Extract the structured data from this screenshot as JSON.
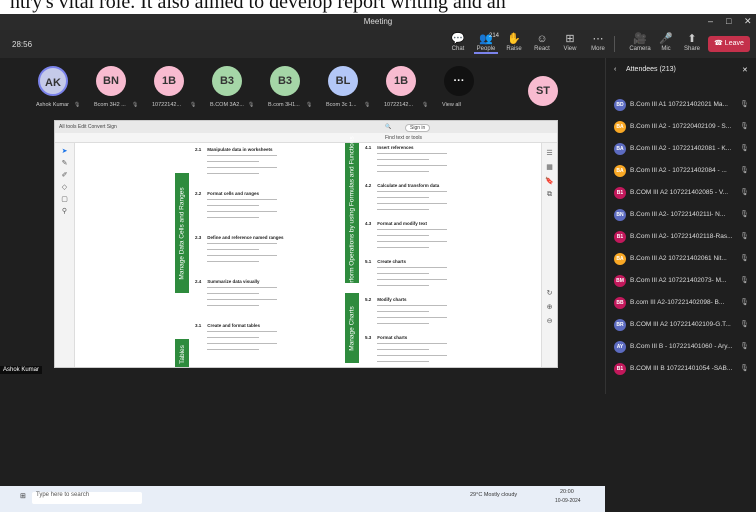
{
  "caption_strip": "ntry's vital role. It also aimed to develop report writing and an",
  "window": {
    "title": "Meeting",
    "minimize": "–",
    "maximize": "□",
    "close": "✕"
  },
  "toolbar": {
    "timer": "28:56",
    "buttons": [
      {
        "icon": "💬",
        "label": "Chat"
      },
      {
        "icon": "👥",
        "label": "People",
        "count": "214"
      },
      {
        "icon": "✋",
        "label": "Raise"
      },
      {
        "icon": "☺",
        "label": "React"
      },
      {
        "icon": "⊞",
        "label": "View"
      },
      {
        "icon": "⋯",
        "label": "More"
      },
      {
        "icon": "🎥",
        "label": "Camera"
      },
      {
        "icon": "🎤",
        "label": "Mic"
      },
      {
        "icon": "⬆",
        "label": "Share"
      }
    ],
    "leave_label": "Leave"
  },
  "participants": [
    {
      "initials": "AK",
      "name": "Ashok Kumar",
      "color": "#c5cae9"
    },
    {
      "initials": "BN",
      "name": "Bcom 3H2 ...",
      "color": "#f8bbd0"
    },
    {
      "initials": "1B",
      "name": "10722142...",
      "color": "#f8bbd0"
    },
    {
      "initials": "B3",
      "name": "B.COM 3A2...",
      "color": "#a5d6a7"
    },
    {
      "initials": "B3",
      "name": "B.com 3H1...",
      "color": "#a5d6a7"
    },
    {
      "initials": "BL",
      "name": "Bcom 3c 1...",
      "color": "#b3c7f7"
    },
    {
      "initials": "1B",
      "name": "10722142...",
      "color": "#f8bbd0"
    },
    {
      "initials": "···",
      "name": "View all",
      "color": "#111111"
    },
    {
      "initials": "ST",
      "name": "",
      "color": "#f8bbd0"
    }
  ],
  "pdf": {
    "find_label": "Find text or tools",
    "sign_in": "Sign in",
    "page_label": "All tools   Edit   Convert   Sign",
    "bands": [
      "Manage Data Cells and Ranges",
      "Perform Operations by using Formulas and Functions",
      "Manage Charts",
      "Tables"
    ],
    "sections_left": [
      {
        "num": "2.1",
        "title": "Manipulate data in worksheets"
      },
      {
        "num": "2.2",
        "title": "Format cells and ranges"
      },
      {
        "num": "2.3",
        "title": "Define and reference named ranges"
      },
      {
        "num": "2.4",
        "title": "Summarize data visually"
      },
      {
        "num": "3.1",
        "title": "Create and format tables"
      }
    ],
    "sections_right": [
      {
        "num": "4.1",
        "title": "Insert references"
      },
      {
        "num": "4.2",
        "title": "Calculate and transform data"
      },
      {
        "num": "4.3",
        "title": "Format and modify text"
      },
      {
        "num": "5.1",
        "title": "Create charts"
      },
      {
        "num": "5.2",
        "title": "Modify charts"
      },
      {
        "num": "5.3",
        "title": "Format charts"
      }
    ]
  },
  "presenter_name": "Ashok Kumar",
  "taskbar": {
    "search": "Type here to search",
    "weather": "29°C  Mostly cloudy",
    "time": "20:00",
    "date": "10-09-2024"
  },
  "attendees": {
    "title": "Attendees (213)",
    "list": [
      {
        "initials": "BD",
        "name": "B.Com III A1 107221402021 Ma...",
        "color": "#5c6bc0"
      },
      {
        "initials": "BA",
        "name": "B.Com III A2 - 107220402109 - S...",
        "color": "#f9a825"
      },
      {
        "initials": "BA",
        "name": "B.Com III A2 - 107221402081 - K...",
        "color": "#5c6bc0"
      },
      {
        "initials": "BA",
        "name": "B.Com III A2 - 107221402084 - ...",
        "color": "#f9a825"
      },
      {
        "initials": "B1",
        "name": "B.COM III A2 107221402085 - V...",
        "color": "#c2185b"
      },
      {
        "initials": "BN",
        "name": "B.Com III A2- 10722140211l- N...",
        "color": "#5c6bc0"
      },
      {
        "initials": "B1",
        "name": "B.Com III A2- 107221402118-Ras...",
        "color": "#c2185b"
      },
      {
        "initials": "BA",
        "name": "B.Com III A2 107221402061 Nit...",
        "color": "#f9a825"
      },
      {
        "initials": "BM",
        "name": "B.Com III A2 107221402073- M...",
        "color": "#c2185b"
      },
      {
        "initials": "BB",
        "name": "B.com III A2-107221402098- B...",
        "color": "#c2185b"
      },
      {
        "initials": "BR",
        "name": "B.COM III A2 107221402109-G.T...",
        "color": "#5c6bc0"
      },
      {
        "initials": "AY",
        "name": "B.Com III B - 107221401060 - Ary...",
        "color": "#5c6bc0"
      },
      {
        "initials": "B1",
        "name": "B.COM III B 107221401054 -SAB...",
        "color": "#c2185b"
      }
    ]
  }
}
